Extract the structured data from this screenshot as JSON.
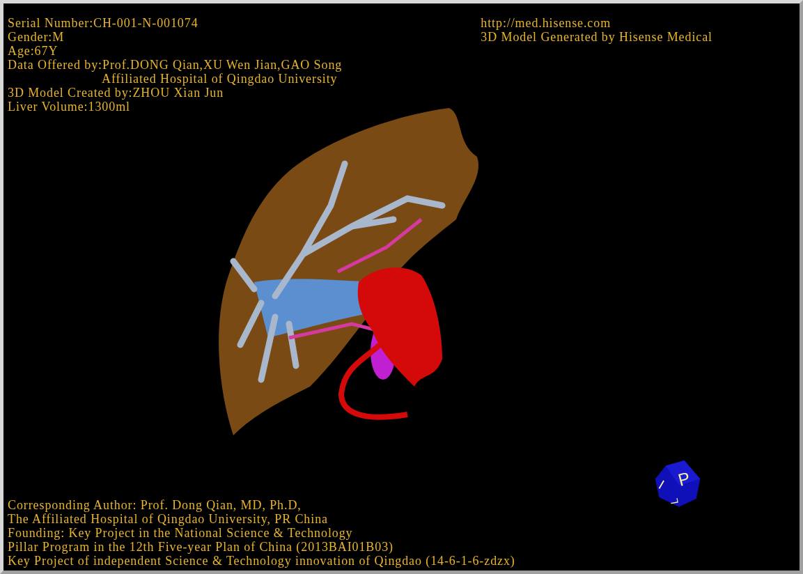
{
  "patient_info": [
    {
      "kind": "line",
      "text": "Serial Number:CH-001-N-001074"
    },
    {
      "kind": "line",
      "text": "Gender:M"
    },
    {
      "kind": "line",
      "text": "Age:67Y"
    },
    {
      "kind": "line",
      "text": "Data Offered by:Prof.DONG Qian,XU Wen Jian,GAO Song"
    },
    {
      "kind": "continuation",
      "text": "Affiliated Hospital of Qingdao University"
    },
    {
      "kind": "line",
      "text": "3D Model Created by:ZHOU Xian Jun"
    },
    {
      "kind": "line",
      "text": "Liver Volume:1300ml"
    }
  ],
  "vendor_info": [
    "http://med.hisense.com",
    "3D Model Generated by Hisense Medical"
  ],
  "orientation_cube": {
    "front": "P",
    "left": "I",
    "bottom": "L"
  },
  "credits": [
    "Corresponding Author: Prof. Dong Qian, MD, Ph.D,",
    "The Affiliated Hospital of Qingdao University, PR China",
    "Founding: Key Project in the National Science & Technology",
    "Pillar Program in the 12th Five-year Plan of China (2013BAI01B03)",
    "Key Project of independent Science & Technology innovation of Qingdao (14-6-1-6-zdzx)"
  ]
}
